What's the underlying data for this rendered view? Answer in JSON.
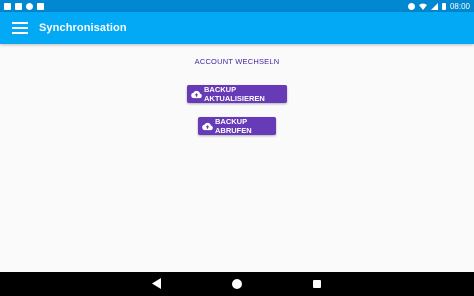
{
  "statusbar": {
    "time": "08:00",
    "left_icons": [
      "mail-icon",
      "message-icon",
      "sync-icon",
      "sd-card-icon"
    ],
    "right_icons": [
      "location-icon",
      "wifi-icon",
      "signal-icon",
      "battery-icon"
    ]
  },
  "appbar": {
    "title": "Synchronisation",
    "menu_icon": "menu-icon"
  },
  "main": {
    "switch_account_label": "ACCOUNT WECHSELN",
    "update_backup_label": "BACKUP AKTUALISIEREN",
    "fetch_backup_label": "BACKUP ABRUFEN",
    "button_icon": "cloud-upload-icon"
  },
  "navbar": {
    "icons": [
      "back-icon",
      "home-icon",
      "recents-icon"
    ]
  },
  "colors": {
    "statusbar": "#0288d1",
    "appbar": "#03a9f4",
    "button": "#673ab7",
    "link": "#4527a0",
    "background": "#fafafa",
    "navbar": "#000000"
  }
}
